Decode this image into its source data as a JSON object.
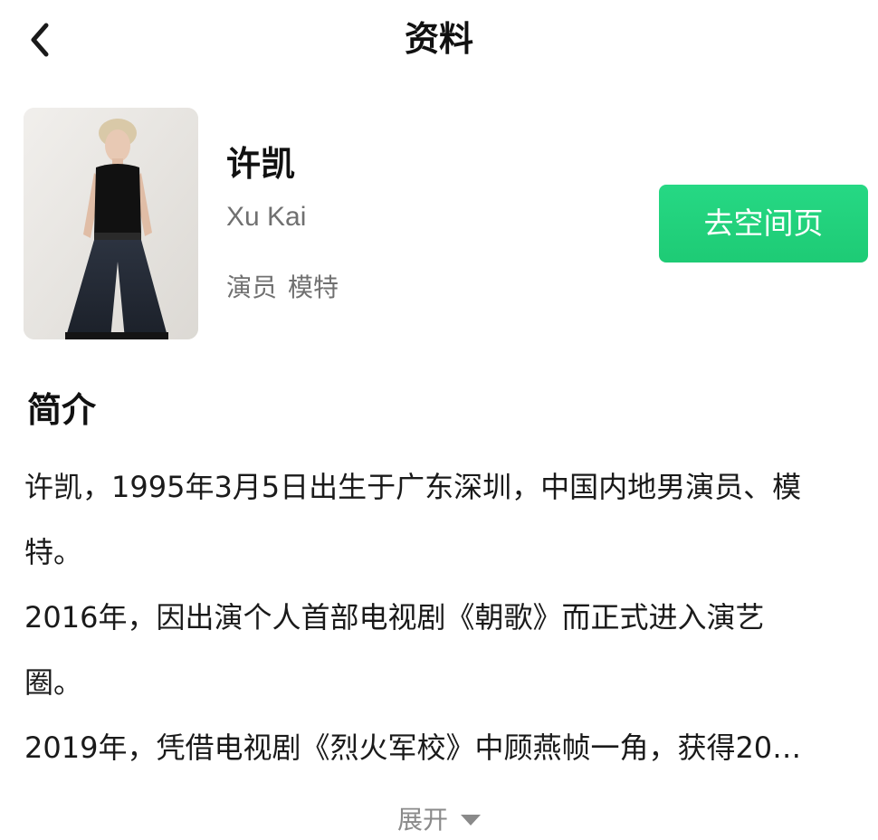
{
  "header": {
    "title": "资料",
    "back_icon": "chevron-left-icon"
  },
  "profile": {
    "name": "许凯",
    "name_en": "Xu Kai",
    "occupations": [
      "演员",
      "模特"
    ],
    "space_button_label": "去空间页",
    "accent_color": "#22d37f"
  },
  "intro": {
    "title": "简介",
    "lines": [
      "许凯，1995年3月5日出生于广东深圳，中国内地男演员、模",
      "特。",
      "2016年，因出演个人首部电视剧《朝歌》而正式进入演艺",
      "圈。",
      "2019年，凭借电视剧《烈火军校》中顾燕帧一角，获得20…"
    ],
    "expand_label": "展开",
    "expand_icon": "caret-down-icon"
  }
}
